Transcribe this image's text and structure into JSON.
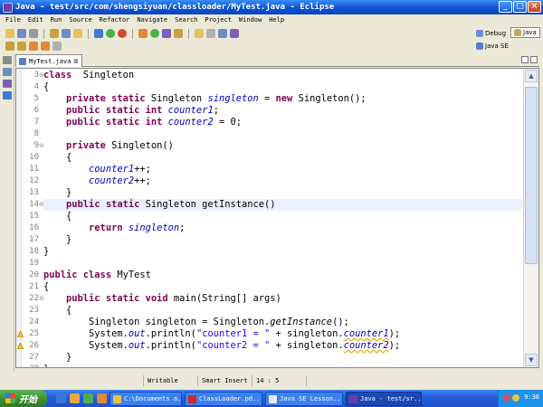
{
  "window": {
    "title": "Java - test/src/com/shengsiyuan/classloader/MyTest.java - Eclipse",
    "controls": {
      "minimize": "_",
      "maximize": "□",
      "close": "×"
    }
  },
  "menu": [
    "File",
    "Edit",
    "Run",
    "Source",
    "Refactor",
    "Navigate",
    "Search",
    "Project",
    "Window",
    "Help"
  ],
  "perspectives": {
    "debug": "Debug",
    "java": "Java",
    "java_se": "Java SE"
  },
  "editor": {
    "tab_label": "MyTest.java",
    "tab_close": "⊠",
    "current_line": 14,
    "lines": [
      {
        "n": "3",
        "fold": "⊖",
        "tokens": [
          [
            "kw",
            "class"
          ],
          [
            "",
            "  Singleton"
          ]
        ]
      },
      {
        "n": "4",
        "tokens": [
          [
            "",
            "{"
          ]
        ]
      },
      {
        "n": "5",
        "tokens": [
          [
            "",
            "    "
          ],
          [
            "kw",
            "private static"
          ],
          [
            "",
            " Singleton "
          ],
          [
            "fld",
            "singleton"
          ],
          [
            "",
            " = "
          ],
          [
            "kw",
            "new"
          ],
          [
            "",
            " Singleton();"
          ]
        ]
      },
      {
        "n": "6",
        "tokens": [
          [
            "",
            "    "
          ],
          [
            "kw",
            "public static int"
          ],
          [
            "",
            " "
          ],
          [
            "fld",
            "counter1"
          ],
          [
            "",
            ";"
          ]
        ]
      },
      {
        "n": "7",
        "tokens": [
          [
            "",
            "    "
          ],
          [
            "kw",
            "public static int"
          ],
          [
            "",
            " "
          ],
          [
            "fld",
            "counter2"
          ],
          [
            "",
            " = 0;"
          ]
        ]
      },
      {
        "n": "8",
        "tokens": [
          [
            "",
            ""
          ]
        ]
      },
      {
        "n": "9",
        "fold": "⊖",
        "tokens": [
          [
            "",
            "    "
          ],
          [
            "kw",
            "private"
          ],
          [
            "",
            " Singleton()"
          ]
        ]
      },
      {
        "n": "10",
        "tokens": [
          [
            "",
            "    {"
          ]
        ]
      },
      {
        "n": "11",
        "tokens": [
          [
            "",
            "        "
          ],
          [
            "fld",
            "counter1"
          ],
          [
            "",
            "++;"
          ]
        ]
      },
      {
        "n": "12",
        "tokens": [
          [
            "",
            "        "
          ],
          [
            "fld",
            "counter2"
          ],
          [
            "",
            "++;"
          ]
        ]
      },
      {
        "n": "13",
        "tokens": [
          [
            "",
            "    }"
          ]
        ]
      },
      {
        "n": "14",
        "fold": "⊖",
        "tokens": [
          [
            "",
            "    "
          ],
          [
            "kw",
            "public static"
          ],
          [
            "",
            " Singleton getInstance()"
          ]
        ]
      },
      {
        "n": "15",
        "tokens": [
          [
            "",
            "    {"
          ]
        ]
      },
      {
        "n": "16",
        "tokens": [
          [
            "",
            "        "
          ],
          [
            "kw",
            "return"
          ],
          [
            "",
            " "
          ],
          [
            "fld",
            "singleton"
          ],
          [
            "",
            ";"
          ]
        ]
      },
      {
        "n": "17",
        "tokens": [
          [
            "",
            "    }"
          ]
        ]
      },
      {
        "n": "18",
        "tokens": [
          [
            "",
            "}"
          ]
        ]
      },
      {
        "n": "19",
        "tokens": [
          [
            "",
            ""
          ]
        ]
      },
      {
        "n": "20",
        "tokens": [
          [
            "kw",
            "public class"
          ],
          [
            "",
            " MyTest"
          ]
        ]
      },
      {
        "n": "21",
        "tokens": [
          [
            "",
            "{"
          ]
        ]
      },
      {
        "n": "22",
        "fold": "⊖",
        "tokens": [
          [
            "",
            "    "
          ],
          [
            "kw",
            "public static void"
          ],
          [
            "",
            " main(String[] args)"
          ]
        ]
      },
      {
        "n": "23",
        "tokens": [
          [
            "",
            "    {"
          ]
        ]
      },
      {
        "n": "24",
        "tokens": [
          [
            "",
            "        Singleton singleton = Singleton."
          ],
          [
            "sm",
            "getInstance"
          ],
          [
            "",
            "();"
          ]
        ]
      },
      {
        "n": "25",
        "warn": true,
        "tokens": [
          [
            "",
            "        System."
          ],
          [
            "fld",
            "out"
          ],
          [
            "",
            ".println("
          ],
          [
            "str",
            "\"counter1 = \""
          ],
          [
            "",
            " + singleton."
          ],
          [
            "fld uw",
            "counter1"
          ],
          [
            "",
            ");"
          ]
        ]
      },
      {
        "n": "26",
        "warn": true,
        "tokens": [
          [
            "",
            "        System."
          ],
          [
            "fld",
            "out"
          ],
          [
            "",
            ".println("
          ],
          [
            "str",
            "\"counter2 = \""
          ],
          [
            "",
            " + singleton."
          ],
          [
            "fld uw",
            "counter2"
          ],
          [
            "",
            ");"
          ]
        ]
      },
      {
        "n": "27",
        "tokens": [
          [
            "",
            "    }"
          ]
        ]
      },
      {
        "n": "28",
        "tokens": [
          [
            "",
            "}"
          ]
        ]
      }
    ]
  },
  "statusbar": {
    "writable": "Writable",
    "insert_mode": "Smart Insert",
    "position": "14 : 5"
  },
  "taskbar": {
    "start": "开始",
    "buttons": [
      {
        "label": "C:\\Documents a...",
        "icon_color": "#f0c040"
      },
      {
        "label": "ClassLoader.pd...",
        "icon_color": "#d02828"
      },
      {
        "label": "Java SE Lesson...",
        "icon_color": "#e8e8e8"
      },
      {
        "label": "Java - test/sr...",
        "icon_color": "#6b3ea8"
      }
    ],
    "clock": "9:36"
  }
}
